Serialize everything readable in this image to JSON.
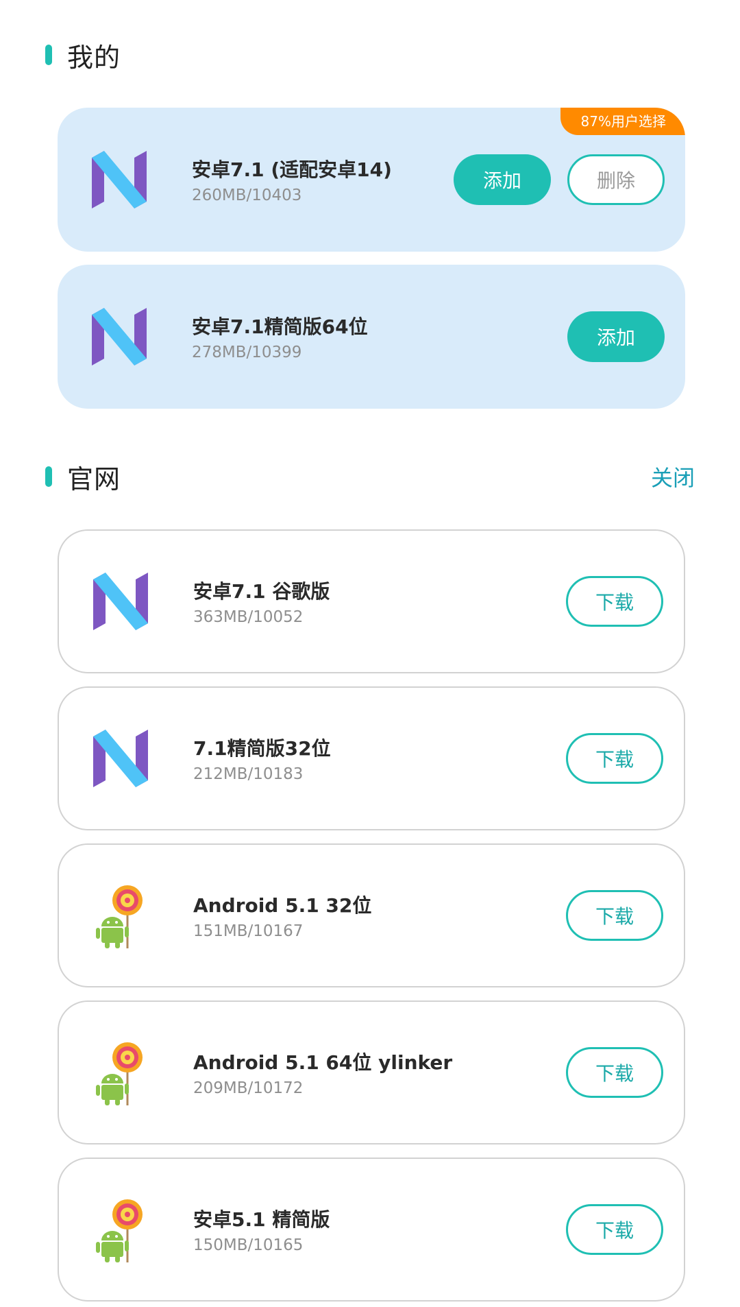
{
  "mine": {
    "title": "我的",
    "items": [
      {
        "title": "安卓7.1 (适配安卓14)",
        "sub": "260MB/10403",
        "badge": "87%用户选择",
        "add_label": "添加",
        "delete_label": "删除",
        "icon": "android-nougat-icon"
      },
      {
        "title": "安卓7.1精简版64位",
        "sub": "278MB/10399",
        "add_label": "添加",
        "icon": "android-nougat-icon"
      }
    ]
  },
  "official": {
    "title": "官网",
    "close_label": "关闭",
    "items": [
      {
        "title": "安卓7.1 谷歌版",
        "sub": "363MB/10052",
        "download_label": "下载",
        "icon": "android-nougat-icon"
      },
      {
        "title": "7.1精简版32位",
        "sub": "212MB/10183",
        "download_label": "下载",
        "icon": "android-nougat-icon"
      },
      {
        "title": "Android 5.1 32位",
        "sub": "151MB/10167",
        "download_label": "下载",
        "icon": "android-lollipop-icon"
      },
      {
        "title": "Android 5.1 64位 ylinker",
        "sub": "209MB/10172",
        "download_label": "下载",
        "icon": "android-lollipop-icon"
      },
      {
        "title": "安卓5.1 精简版",
        "sub": "150MB/10165",
        "download_label": "下载",
        "icon": "android-lollipop-icon"
      }
    ]
  },
  "colors": {
    "accent": "#1fbfb3",
    "mine_card_bg": "#d9ebfa",
    "badge": "#ff8a00",
    "close_link": "#1a9fb7"
  }
}
